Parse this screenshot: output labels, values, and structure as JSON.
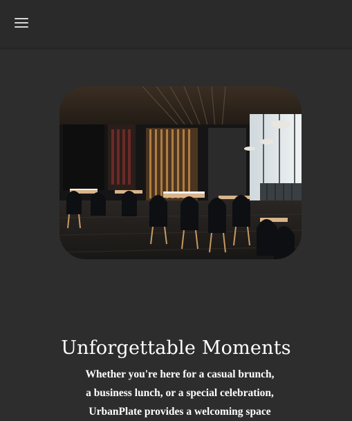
{
  "header": {
    "menu_icon": "hamburger-menu-icon"
  },
  "hero": {
    "image_subject": "restaurant-dining-room-photo"
  },
  "section": {
    "title": "Unforgettable Moments",
    "lines": [
      "Whether you're here for a casual brunch,",
      "a business lunch, or a special celebration,",
      "UrbanPlate provides a welcoming space"
    ]
  },
  "colors": {
    "background": "#2d2d2d",
    "header_bg": "#2a2a2a",
    "text": "#ffffff",
    "icon": "#d8d8d8"
  }
}
